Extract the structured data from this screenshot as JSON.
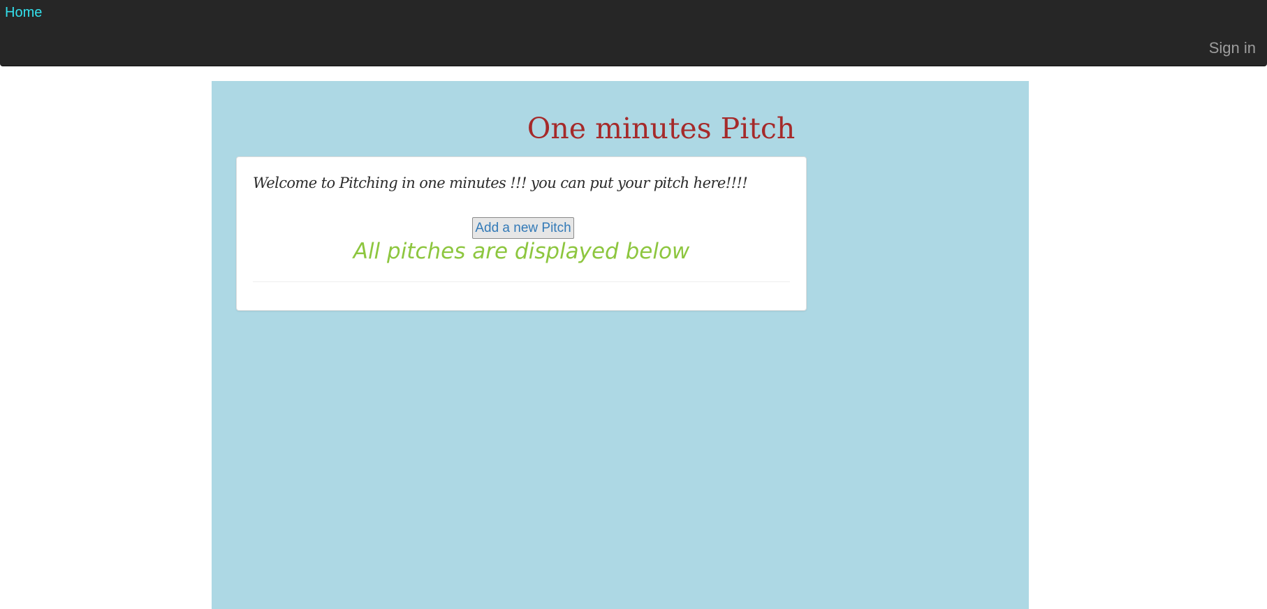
{
  "navbar": {
    "home_label": "Home",
    "signin_label": "Sign in"
  },
  "main": {
    "title": "One minutes Pitch",
    "panel": {
      "welcome_text": "Welcome to Pitching in one minutes !!! you can put your pitch here!!!!",
      "add_button_label": "Add a new Pitch",
      "subheading": "All pitches are displayed below"
    }
  },
  "colors": {
    "navbar_bg": "#262626",
    "home_link": "#33e0ec",
    "signin_link": "#9d9d9d",
    "main_bg": "#add8e4",
    "title": "#a52a2a",
    "subheading": "#8dc63f",
    "button_text": "#337ab7"
  }
}
